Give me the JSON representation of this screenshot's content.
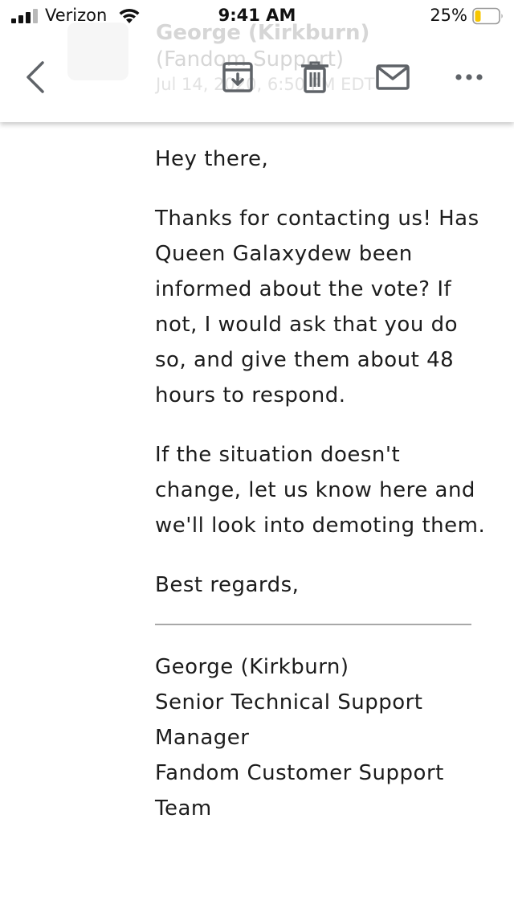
{
  "status_bar": {
    "carrier": "Verizon",
    "time": "9:41 AM",
    "battery_percent": "25%",
    "battery_level": 0.25,
    "battery_color": "#f7c600"
  },
  "header": {
    "sender_name": "George (Kirkburn)",
    "sender_org": "(Fandom Support)",
    "date": "Jul 14, 2020, 6:50 PM EDT",
    "icons": [
      "chevron-left-icon",
      "archive-icon",
      "trash-icon",
      "mail-icon",
      "more-icon"
    ]
  },
  "email": {
    "greeting": "Hey there,",
    "paragraph1": "Thanks for contacting us! Has Queen Galaxydew been informed about the vote? If not, I would ask that you do so, and give them about 48 hours to respond.",
    "paragraph2": "If the situation doesn't change, let us know here and we'll look into demoting them.",
    "closing": "Best regards,",
    "signature": {
      "name": "George (Kirkburn)",
      "title": "Senior Technical Support Manager",
      "team": "Fandom Customer Support Team"
    }
  },
  "colors": {
    "icon_gray": "#5f6368",
    "divider": "#a8a8a8"
  }
}
